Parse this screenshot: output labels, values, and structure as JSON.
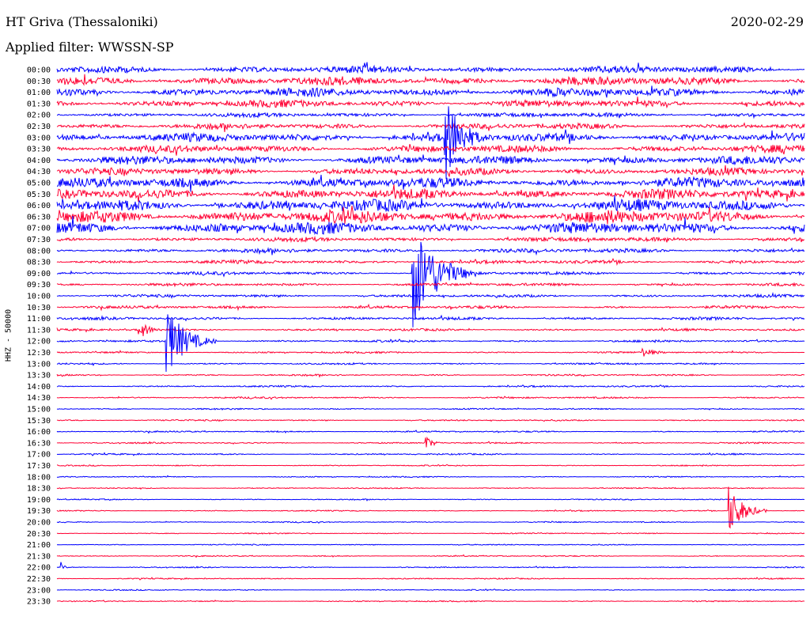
{
  "header": {
    "station": "HT Griva (Thessaloniki)",
    "filter": "Applied filter: WWSSN-SP",
    "date": "2020-02-29"
  },
  "channel_label": "HHZ - 50000",
  "colors": {
    "blue": "#0000ff",
    "red": "#ff0033"
  },
  "chart_data": {
    "type": "helicorder",
    "title": "HT Griva (Thessaloniki)",
    "subtitle": "Applied filter: WWSSN-SP",
    "date": "2020-02-29",
    "channel": "HHZ - 50000",
    "line_minutes": 30,
    "row_labels": [
      "00:00",
      "00:30",
      "01:00",
      "01:30",
      "02:00",
      "02:30",
      "03:00",
      "03:30",
      "04:00",
      "04:30",
      "05:00",
      "05:30",
      "06:00",
      "06:30",
      "07:00",
      "07:30",
      "08:00",
      "08:30",
      "09:00",
      "09:30",
      "10:00",
      "10:30",
      "11:00",
      "11:30",
      "12:00",
      "12:30",
      "13:00",
      "13:30",
      "14:00",
      "14:30",
      "15:00",
      "15:30",
      "16:00",
      "16:30",
      "17:00",
      "17:30",
      "18:00",
      "18:30",
      "19:00",
      "19:30",
      "20:00",
      "20:30",
      "21:00",
      "21:30",
      "22:00",
      "22:30",
      "23:00",
      "23:30"
    ],
    "trace_colors": [
      "blue",
      "red"
    ],
    "noise_levels": [
      5,
      6,
      6,
      5,
      3,
      4,
      6,
      5,
      6,
      5,
      7,
      7,
      8,
      9,
      8,
      3,
      3,
      2.5,
      2.2,
      2,
      2,
      2,
      2,
      1.5,
      1.5,
      1.2,
      1.2,
      1.2,
      1.2,
      1.2,
      1,
      1,
      1,
      1,
      1,
      0.8,
      0.8,
      0.8,
      0.8,
      0.8,
      0.8,
      0.8,
      0.8,
      0.8,
      0.8,
      0.8,
      0.8,
      0.8
    ],
    "events": [
      {
        "line": 24,
        "minute": 4.4,
        "amplitude": 45,
        "duration_min": 2.0
      },
      {
        "line": 23,
        "minute": 3.3,
        "amplitude": 12,
        "duration_min": 1.2
      },
      {
        "line": 18,
        "minute": 14.3,
        "amplitude": 70,
        "duration_min": 2.5
      },
      {
        "line": 6,
        "minute": 15.6,
        "amplitude": 55,
        "duration_min": 1.8
      },
      {
        "line": 25,
        "minute": 23.5,
        "amplitude": 6,
        "duration_min": 1.5
      },
      {
        "line": 33,
        "minute": 14.8,
        "amplitude": 9,
        "duration_min": 0.8
      },
      {
        "line": 39,
        "minute": 27.0,
        "amplitude": 30,
        "duration_min": 1.5
      },
      {
        "line": 44,
        "minute": 0.2,
        "amplitude": 5,
        "duration_min": 0.4
      }
    ]
  }
}
